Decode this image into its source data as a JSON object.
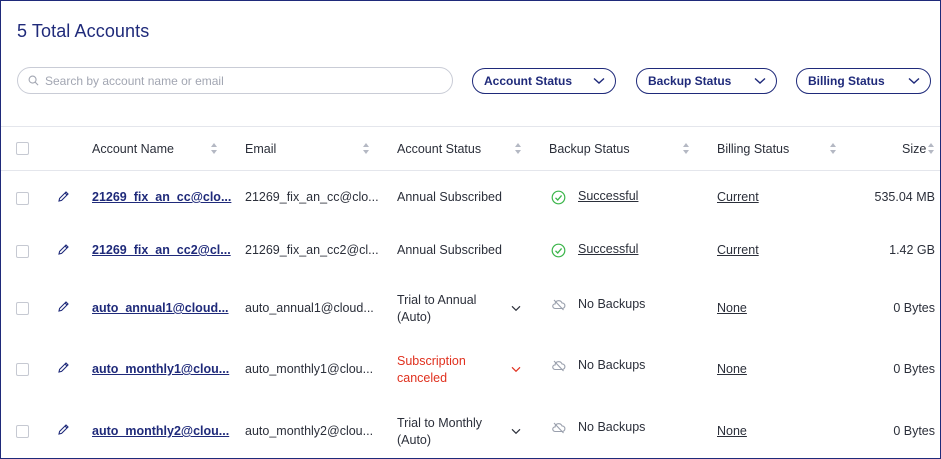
{
  "header": {
    "title": "5 Total Accounts"
  },
  "search": {
    "placeholder": "Search by account name or email",
    "value": ""
  },
  "filters": [
    {
      "label": "Account Status"
    },
    {
      "label": "Backup Status"
    },
    {
      "label": "Billing Status"
    }
  ],
  "table": {
    "columns": [
      "Account Name",
      "Email",
      "Account Status",
      "Backup Status",
      "Billing Status",
      "Size"
    ],
    "rows": [
      {
        "name": "21269_fix_an_cc@clo...",
        "email": "21269_fix_an_cc@clo...",
        "status_line1": "Annual Subscribed",
        "status_line2": "",
        "status_color": "normal",
        "backup": "Successful",
        "backup_icon": "check-circle-icon",
        "billing": "Current",
        "size": "535.04 MB"
      },
      {
        "name": "21269_fix_an_cc2@cl...",
        "email": "21269_fix_an_cc2@cl...",
        "status_line1": "Annual Subscribed",
        "status_line2": "",
        "status_color": "normal",
        "backup": "Successful",
        "backup_icon": "check-circle-icon",
        "billing": "Current",
        "size": "1.42 GB"
      },
      {
        "name": "auto_annual1@cloud...",
        "email": "auto_annual1@cloud...",
        "status_line1": "Trial to Annual",
        "status_line2": "(Auto)",
        "status_color": "normal",
        "backup": "No Backups",
        "backup_icon": "cloud-icon",
        "billing": "None",
        "size": "0 Bytes"
      },
      {
        "name": "auto_monthly1@clou...",
        "email": "auto_monthly1@clou...",
        "status_line1": "Subscription",
        "status_line2": "canceled",
        "status_color": "red",
        "backup": "No Backups",
        "backup_icon": "cloud-icon",
        "billing": "None",
        "size": "0 Bytes"
      },
      {
        "name": "auto_monthly2@clou...",
        "email": "auto_monthly2@clou...",
        "status_line1": "Trial to Monthly",
        "status_line2": "(Auto)",
        "status_color": "normal",
        "backup": "No Backups",
        "backup_icon": "cloud-icon",
        "billing": "None",
        "size": "0 Bytes"
      }
    ]
  },
  "colors": {
    "brand": "#1f2a7a",
    "success": "#3bb54a",
    "danger": "#e0301e",
    "border": "#e4e6ec"
  }
}
